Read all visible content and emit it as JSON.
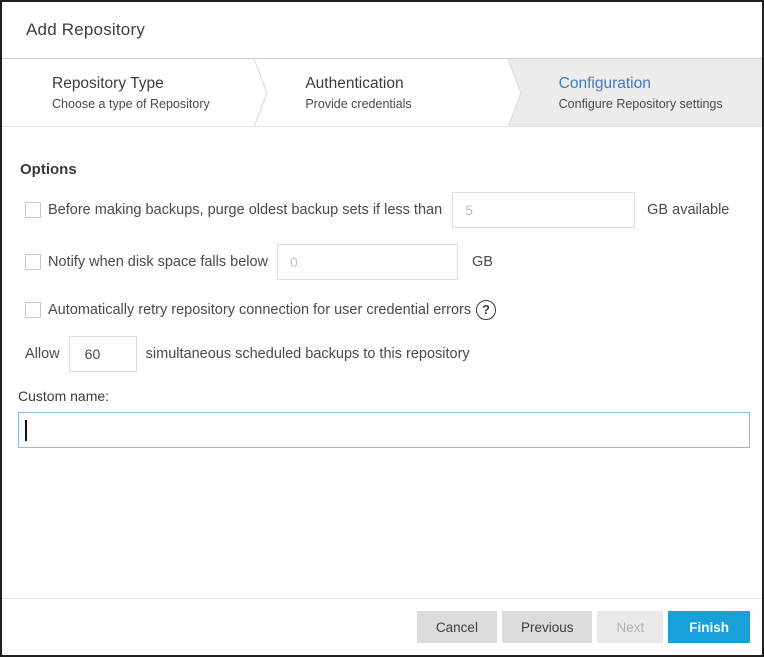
{
  "dialog": {
    "title": "Add Repository"
  },
  "steps": [
    {
      "title": "Repository Type",
      "subtitle": "Choose a type of Repository",
      "active": false
    },
    {
      "title": "Authentication",
      "subtitle": "Provide credentials",
      "active": false
    },
    {
      "title": "Configuration",
      "subtitle": "Configure Repository settings",
      "active": true
    }
  ],
  "options": {
    "heading": "Options",
    "purge": {
      "checked": false,
      "label": "Before making backups, purge oldest backup sets if less than",
      "placeholder": "5",
      "value": "",
      "suffix": "GB available"
    },
    "notify": {
      "checked": false,
      "label": "Notify when disk space falls below",
      "placeholder": "0",
      "value": "",
      "suffix": "GB"
    },
    "retry": {
      "checked": false,
      "label": "Automatically retry repository connection for user credential errors",
      "help_glyph": "?"
    },
    "allow": {
      "prefix": "Allow",
      "value": "60",
      "suffix": "simultaneous scheduled backups to this repository"
    }
  },
  "custom_name": {
    "label": "Custom name:",
    "value": ""
  },
  "footer": {
    "cancel_label": "Cancel",
    "previous_label": "Previous",
    "next_label": "Next",
    "finish_label": "Finish"
  },
  "colors": {
    "accent_blue": "#3d7cc0",
    "finish_blue": "#18a0da",
    "step_active_bg": "#ececec",
    "border_dark": "#1f1f1f"
  }
}
